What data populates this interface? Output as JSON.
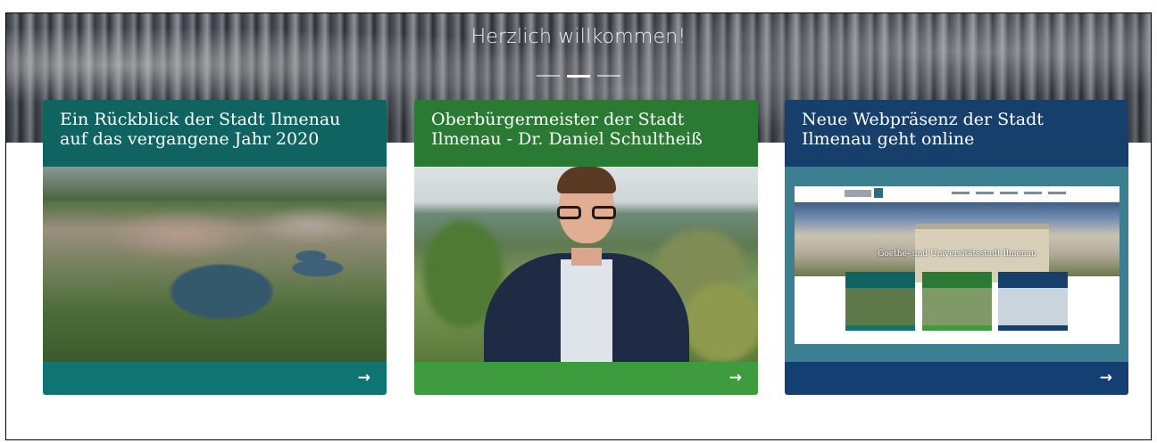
{
  "hero": {
    "title": "Herzlich willkommen!",
    "slides": 3,
    "active_slide": 2
  },
  "cards": [
    {
      "title": "Ein Rückblick der Stadt Ilmenau auf das vergangene Jahr 2020",
      "image": "aerial-photo-ilmenau",
      "arrow": "→",
      "head_color": "#0f6462",
      "foot_color": "#0f7572"
    },
    {
      "title": "Oberbürgermeister der Stadt Ilmenau - Dr. Daniel Schultheiß",
      "image": "portrait-photo",
      "arrow": "→",
      "head_color": "#2a7a33",
      "foot_color": "#3e9b3e"
    },
    {
      "title": "Neue Webpräsenz der Stadt Ilmenau geht online",
      "image": "website-screenshot",
      "screenshot_caption": "Goethe- und Universitätsstadt Ilmenau",
      "arrow": "→",
      "head_color": "#173f6b",
      "foot_color": "#143f73"
    }
  ]
}
